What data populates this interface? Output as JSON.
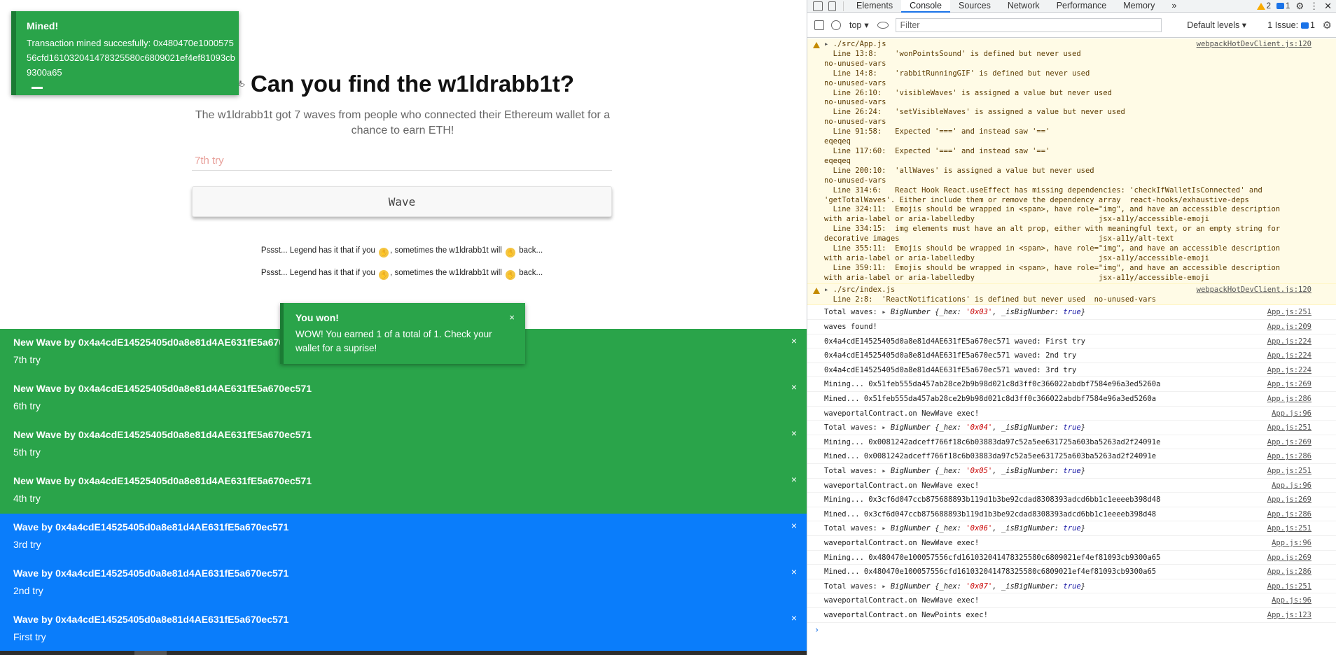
{
  "app": {
    "title": "Can you find the w1ldrabb1t?",
    "subtitle": "The w1ldrabb1t got 7 waves from people who connected their Ethereum wallet for a chance to earn ETH!",
    "input_value": "",
    "input_placeholder": "7th try",
    "wave_button_label": "Wave",
    "hints": [
      {
        "before": "Pssst... Legend has it that if you",
        "middle": ", sometimes the w1ldrabb1t will",
        "after": "back..."
      },
      {
        "before": "Pssst... Legend has it that if you",
        "middle": ", sometimes the w1ldrabb1t will",
        "after": "back..."
      }
    ],
    "notifications": [
      {
        "variant": "green",
        "title": "New Wave by 0x4a4cdE14525405d0a8e81d4AE631fE5a670ec571",
        "message": "7th try"
      },
      {
        "variant": "green",
        "title": "New Wave by 0x4a4cdE14525405d0a8e81d4AE631fE5a670ec571",
        "message": "6th try"
      },
      {
        "variant": "green",
        "title": "New Wave by 0x4a4cdE14525405d0a8e81d4AE631fE5a670ec571",
        "message": "5th try"
      },
      {
        "variant": "green",
        "title": "New Wave by 0x4a4cdE14525405d0a8e81d4AE631fE5a670ec571",
        "message": "4th try"
      },
      {
        "variant": "blue",
        "title": "Wave by 0x4a4cdE14525405d0a8e81d4AE631fE5a670ec571",
        "message": "3rd try"
      },
      {
        "variant": "blue",
        "title": "Wave by 0x4a4cdE14525405d0a8e81d4AE631fE5a670ec571",
        "message": "2nd try"
      },
      {
        "variant": "blue",
        "title": "Wave by 0x4a4cdE14525405d0a8e81d4AE631fE5a670ec571",
        "message": "First try"
      }
    ],
    "close_glyph": "×",
    "toast_mined": {
      "title": "Mined!",
      "message": "Transaction mined succesfully: 0x480470e100057556cfd161032041478325580c6809021ef4ef81093cb9300a65"
    },
    "toast_won": {
      "title": "You won!",
      "message": "WOW! You earned 1 of a total of 1. Check your wallet for a suprise!"
    },
    "colors": {
      "green": "#2aa44a",
      "blue": "#0a7dfb"
    }
  },
  "devtools": {
    "tabs": [
      "Elements",
      "Console",
      "Sources",
      "Network",
      "Performance",
      "Memory"
    ],
    "active_tab": "Console",
    "more_glyph": "»",
    "warnings_count": "2",
    "messages_count": "1",
    "context": "top",
    "filter_placeholder": "Filter",
    "levels_label": "Default levels",
    "issues_label": "1 Issue:",
    "issues_count": "1",
    "warnings": [
      {
        "path": "./src/App.js",
        "source": "webpackHotDevClient.js:120",
        "lines": [
          "  Line 13:8:    'wonPointsSound' is defined but never used",
          "no-unused-vars",
          "  Line 14:8:    'rabbitRunningGIF' is defined but never used",
          "no-unused-vars",
          "  Line 26:10:   'visibleWaves' is assigned a value but never used",
          "no-unused-vars",
          "  Line 26:24:   'setVisibleWaves' is assigned a value but never used",
          "no-unused-vars",
          "  Line 91:58:   Expected '===' and instead saw '=='",
          "eqeqeq",
          "  Line 117:60:  Expected '===' and instead saw '=='",
          "eqeqeq",
          "  Line 200:10:  'allWaves' is assigned a value but never used",
          "no-unused-vars",
          "  Line 314:6:   React Hook React.useEffect has missing dependencies: 'checkIfWalletIsConnected' and",
          "'getTotalWaves'. Either include them or remove the dependency array  react-hooks/exhaustive-deps",
          "  Line 324:11:  Emojis should be wrapped in <span>, have role=\"img\", and have an accessible description",
          "with aria-label or aria-labelledby                            jsx-a11y/accessible-emoji",
          "  Line 334:15:  img elements must have an alt prop, either with meaningful text, or an empty string for",
          "decorative images                                             jsx-a11y/alt-text",
          "  Line 355:11:  Emojis should be wrapped in <span>, have role=\"img\", and have an accessible description",
          "with aria-label or aria-labelledby                            jsx-a11y/accessible-emoji",
          "  Line 359:11:  Emojis should be wrapped in <span>, have role=\"img\", and have an accessible description",
          "with aria-label or aria-labelledby                            jsx-a11y/accessible-emoji"
        ]
      },
      {
        "path": "./src/index.js",
        "source": "webpackHotDevClient.js:120",
        "lines": [
          "  Line 2:8:  'ReactNotifications' is defined but never used  no-unused-vars"
        ]
      }
    ],
    "logs": [
      {
        "text": "Total waves: ",
        "obj": {
          "label": "BigNumber",
          "hex": "'0x03'",
          "bool": "true"
        },
        "source": "App.js:251"
      },
      {
        "text": "waves found!",
        "source": "App.js:209"
      },
      {
        "text": "0x4a4cdE14525405d0a8e81d4AE631fE5a670ec571 waved: First try",
        "source": "App.js:224"
      },
      {
        "text": "0x4a4cdE14525405d0a8e81d4AE631fE5a670ec571 waved: 2nd try",
        "source": "App.js:224"
      },
      {
        "text": "0x4a4cdE14525405d0a8e81d4AE631fE5a670ec571 waved: 3rd try",
        "source": "App.js:224"
      },
      {
        "text": "Mining... 0x51feb555da457ab28ce2b9b98d021c8d3ff0c366022abdbf7584e96a3ed5260a",
        "source": "App.js:269"
      },
      {
        "text": "Mined... 0x51feb555da457ab28ce2b9b98d021c8d3ff0c366022abdbf7584e96a3ed5260a",
        "source": "App.js:286"
      },
      {
        "text": "waveportalContract.on NewWave exec!",
        "source": "App.js:96"
      },
      {
        "text": "Total waves: ",
        "obj": {
          "label": "BigNumber",
          "hex": "'0x04'",
          "bool": "true"
        },
        "source": "App.js:251"
      },
      {
        "text": "Mining... 0x0081242adceff766f18c6b03883da97c52a5ee631725a603ba5263ad2f24091e",
        "source": "App.js:269"
      },
      {
        "text": "Mined... 0x0081242adceff766f18c6b03883da97c52a5ee631725a603ba5263ad2f24091e",
        "source": "App.js:286"
      },
      {
        "text": "Total waves: ",
        "obj": {
          "label": "BigNumber",
          "hex": "'0x05'",
          "bool": "true"
        },
        "source": "App.js:251"
      },
      {
        "text": "waveportalContract.on NewWave exec!",
        "source": "App.js:96"
      },
      {
        "text": "Mining... 0x3cf6d047ccb875688893b119d1b3be92cdad8308393adcd6bb1c1eeeeb398d48",
        "source": "App.js:269"
      },
      {
        "text": "Mined... 0x3cf6d047ccb875688893b119d1b3be92cdad8308393adcd6bb1c1eeeeb398d48",
        "source": "App.js:286"
      },
      {
        "text": "Total waves: ",
        "obj": {
          "label": "BigNumber",
          "hex": "'0x06'",
          "bool": "true"
        },
        "source": "App.js:251"
      },
      {
        "text": "waveportalContract.on NewWave exec!",
        "source": "App.js:96"
      },
      {
        "text": "Mining... 0x480470e100057556cfd161032041478325580c6809021ef4ef81093cb9300a65",
        "source": "App.js:269"
      },
      {
        "text": "Mined... 0x480470e100057556cfd161032041478325580c6809021ef4ef81093cb9300a65",
        "source": "App.js:286"
      },
      {
        "text": "Total waves: ",
        "obj": {
          "label": "BigNumber",
          "hex": "'0x07'",
          "bool": "true"
        },
        "source": "App.js:251"
      },
      {
        "text": "waveportalContract.on NewWave exec!",
        "source": "App.js:96"
      },
      {
        "text": "waveportalContract.on NewPoints exec!",
        "source": "App.js:123"
      }
    ],
    "prompt_glyph": "›"
  }
}
